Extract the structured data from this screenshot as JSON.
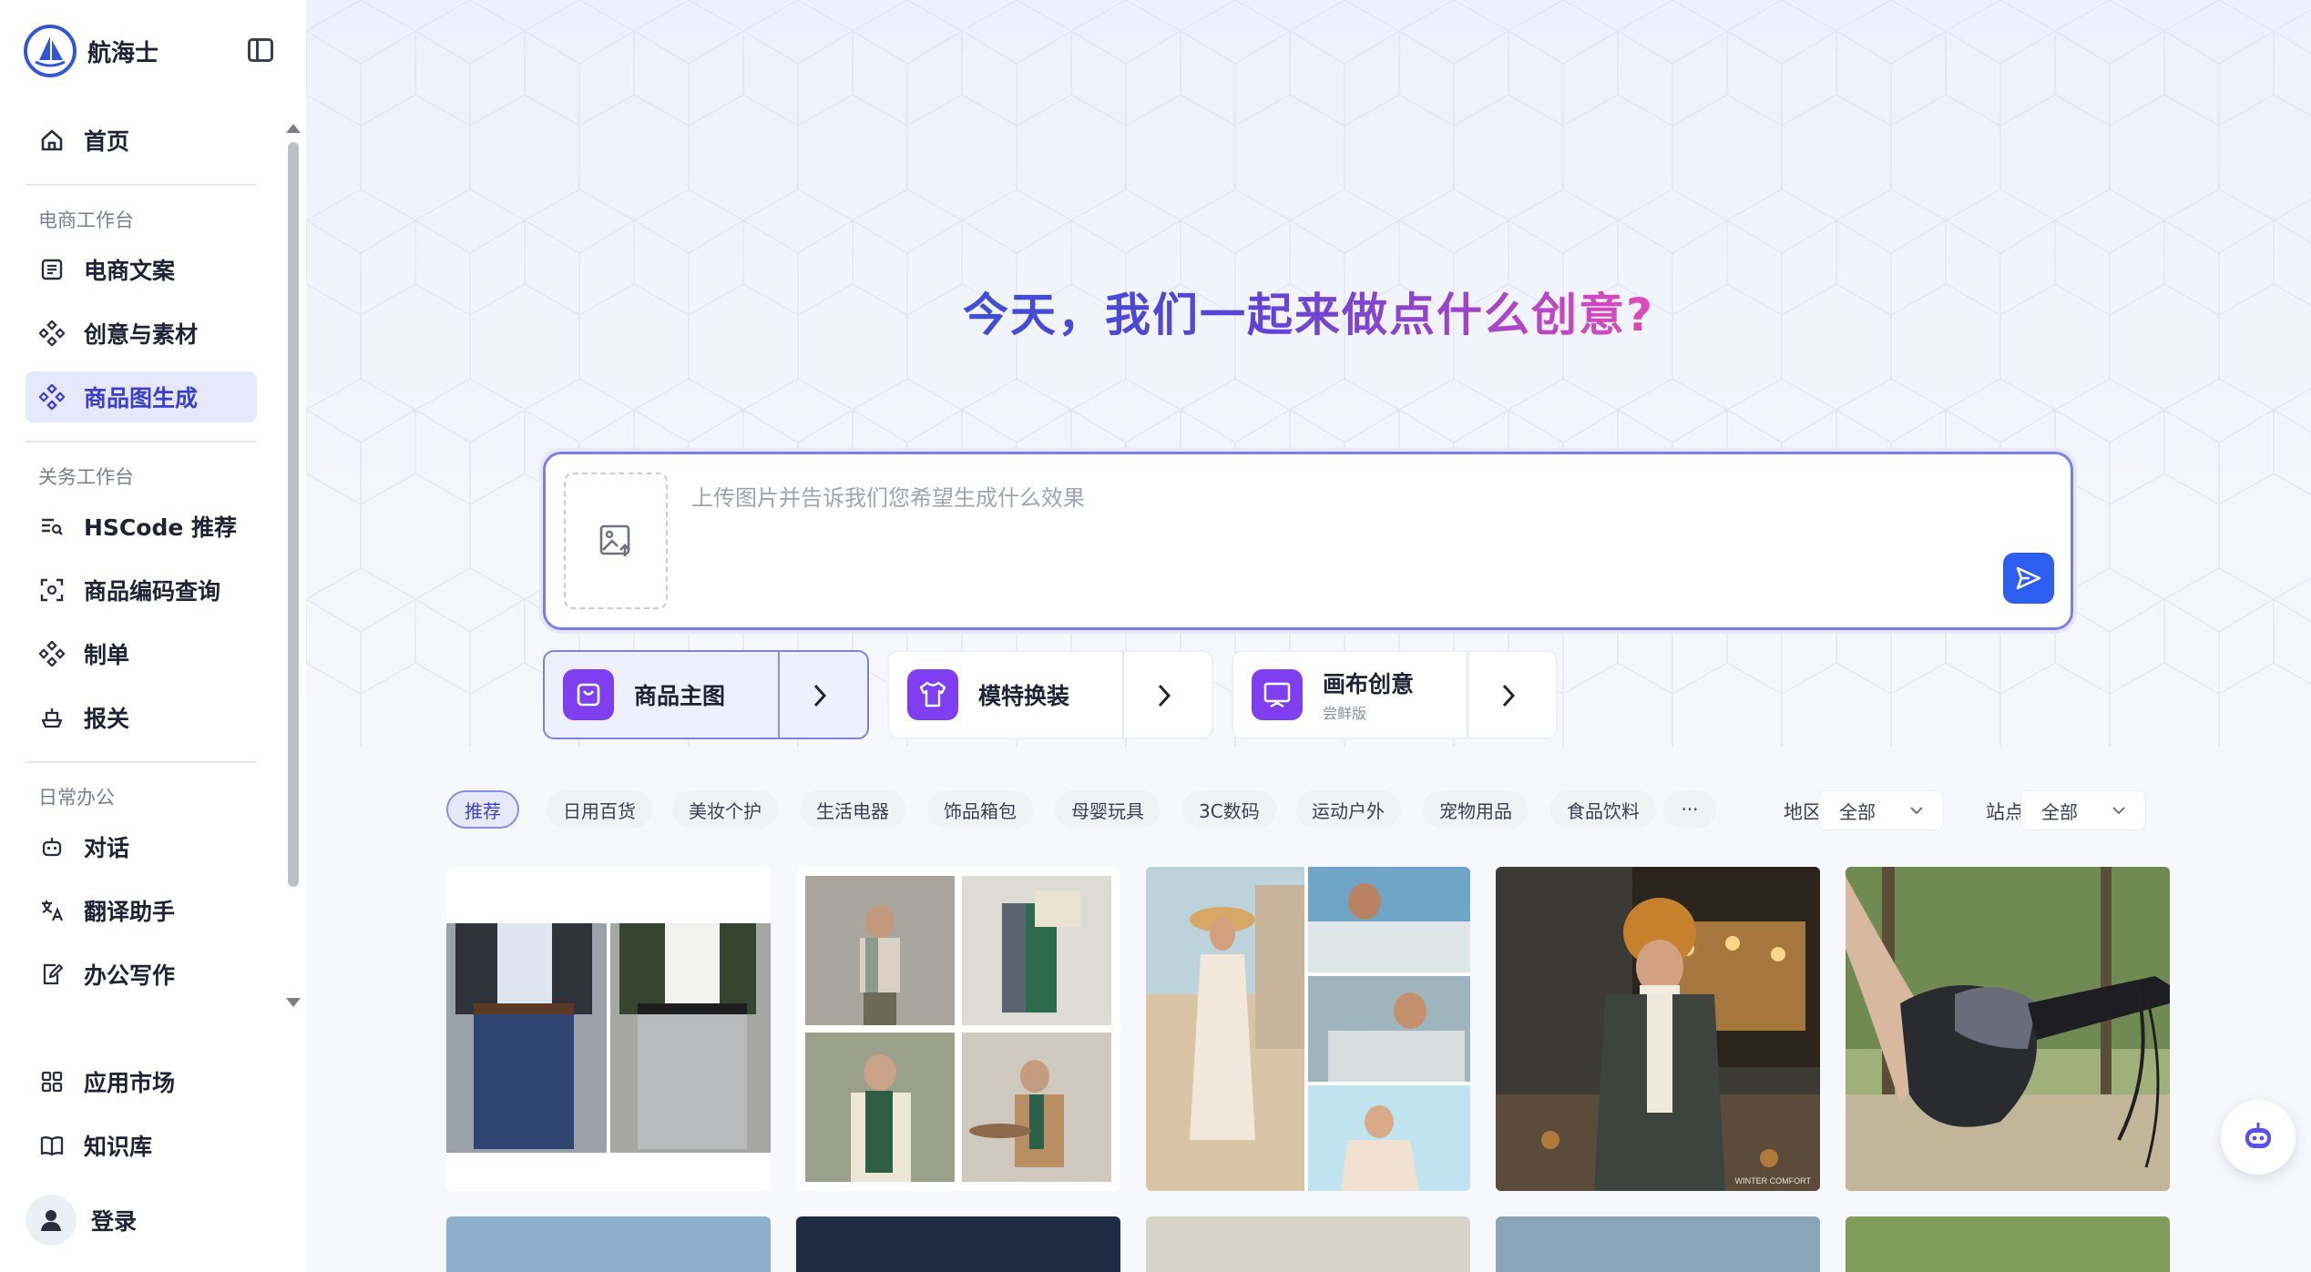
{
  "brand": {
    "name": "航海士"
  },
  "sidebar": {
    "home": "首页",
    "sections": [
      {
        "label": "电商工作台",
        "items": [
          "电商文案",
          "创意与素材",
          "商品图生成"
        ]
      },
      {
        "label": "关务工作台",
        "items": [
          "HSCode 推荐",
          "商品编码查询",
          "制单",
          "报关"
        ]
      },
      {
        "label": "日常办公",
        "items": [
          "对话",
          "翻译助手",
          "办公写作"
        ]
      }
    ],
    "bottom": [
      "应用市场",
      "知识库"
    ],
    "active_item": "商品图生成",
    "login": "登录"
  },
  "main": {
    "headline": "今天，我们一起来做点什么创意?",
    "prompt": {
      "placeholder": "上传图片并告诉我们您希望生成什么效果",
      "value": ""
    },
    "tools": [
      {
        "title": "商品主图",
        "sub": "",
        "icon": "shopping-bag-icon",
        "active": true
      },
      {
        "title": "模特换装",
        "sub": "",
        "icon": "tshirt-icon",
        "active": false
      },
      {
        "title": "画布创意",
        "sub": "尝鲜版",
        "icon": "canvas-icon",
        "active": false
      }
    ],
    "categories": [
      "推荐",
      "日用百货",
      "美妆个护",
      "生活电器",
      "饰品箱包",
      "母婴玩具",
      "3C数码",
      "运动户外",
      "宠物用品",
      "食品饮料",
      "···"
    ],
    "active_category": "推荐",
    "filters": {
      "region_label": "地区:",
      "region_value": "全部",
      "site_label": "站点:",
      "site_value": "全部"
    },
    "gallery": [
      {
        "subject": "jeans-and-trousers"
      },
      {
        "subject": "scarf-models-grid"
      },
      {
        "subject": "summer-sunglasses-collage"
      },
      {
        "subject": "winter-scarf-woman",
        "caption": "WINTER COMFORT"
      },
      {
        "subject": "cycling-glove"
      }
    ]
  },
  "colors": {
    "accent": "#3b3fc9",
    "primary_button": "#2e5ef0",
    "tool_icon": "#7f3ff0",
    "active_bg": "#e6e9fb"
  }
}
